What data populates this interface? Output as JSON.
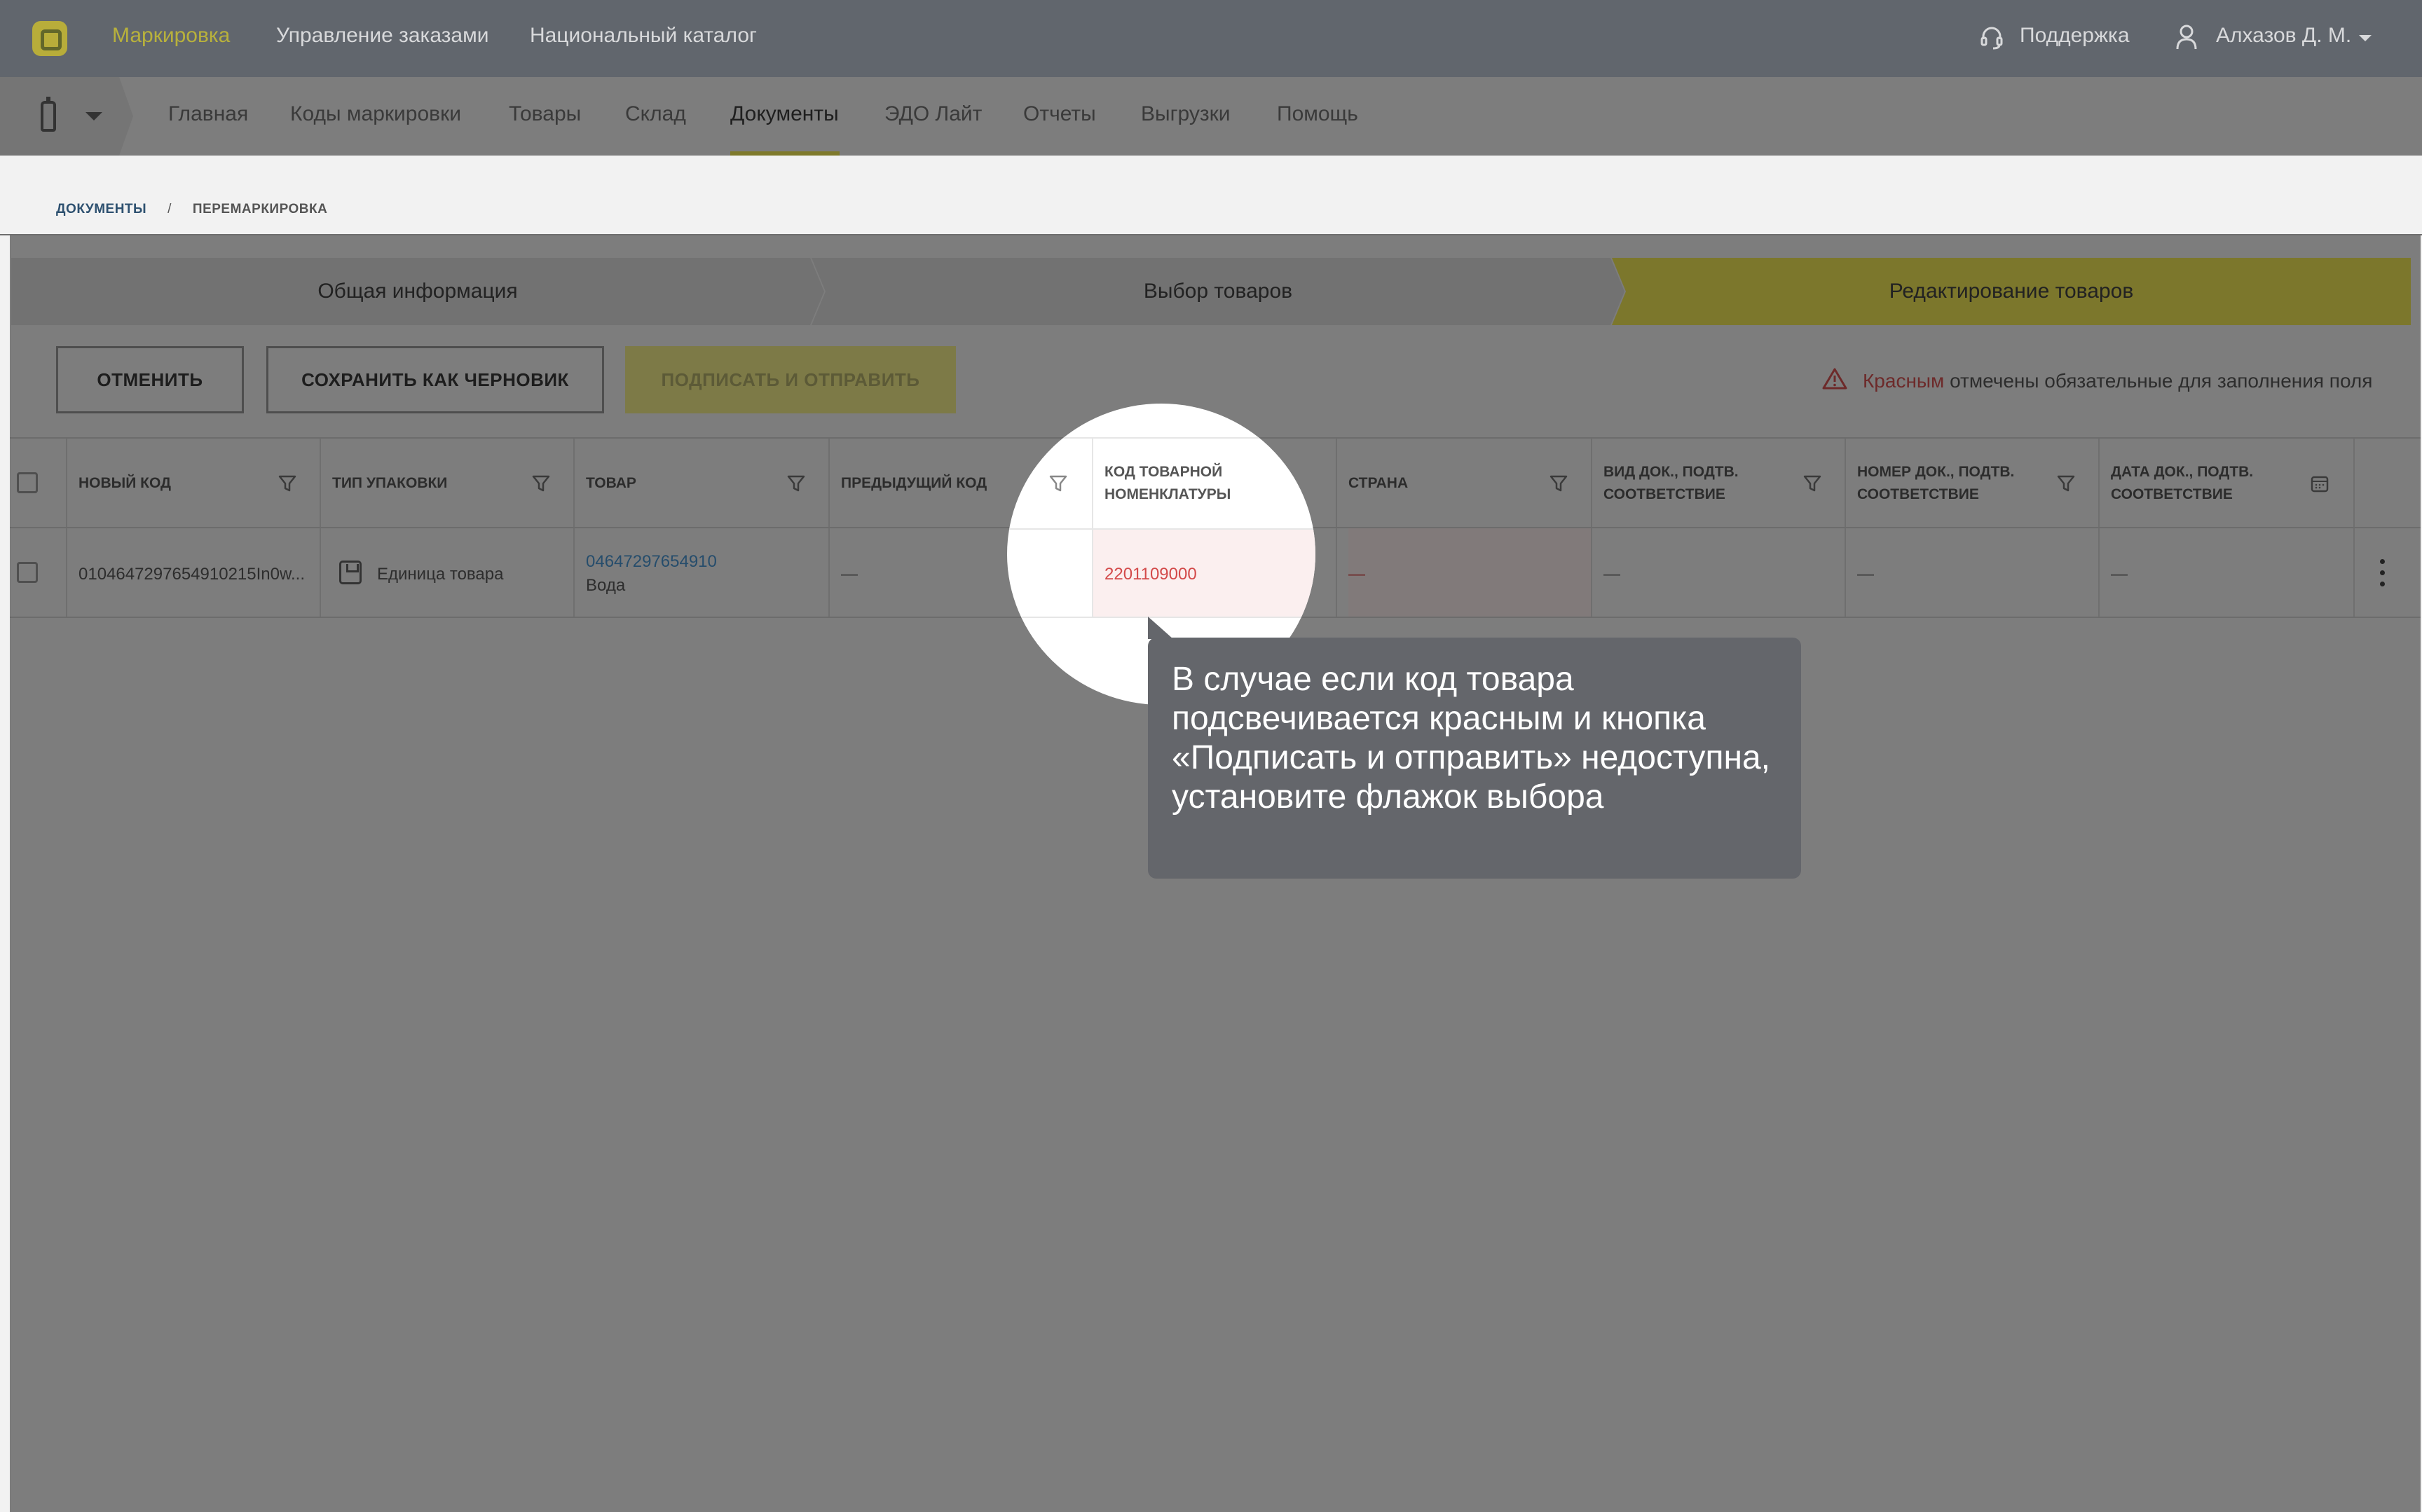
{
  "topbar": {
    "nav": [
      "Маркировка",
      "Управление заказами",
      "Национальный каталог"
    ],
    "active_index": 0,
    "support": "Поддержка",
    "user": "Алхазов Д. М."
  },
  "subnav": {
    "items": [
      "Главная",
      "Коды маркировки",
      "Товары",
      "Склад",
      "Документы",
      "ЭДО Лайт",
      "Отчеты",
      "Выгрузки",
      "Помощь"
    ],
    "active": "Документы"
  },
  "breadcrumb": {
    "root": "ДОКУМЕНТЫ",
    "separator": "/",
    "current": "ПЕРЕМАРКИРОВКА"
  },
  "steps": [
    "Общая информация",
    "Выбор товаров",
    "Редактирование товаров"
  ],
  "active_step": 2,
  "buttons": {
    "cancel": "ОТМЕНИТЬ",
    "save_draft": "СОХРАНИТЬ КАК ЧЕРНОВИК",
    "sign_send": "ПОДПИСАТЬ И ОТПРАВИТЬ"
  },
  "legend": {
    "red_word": "Красным",
    "rest": " отмечены обязательные для заполнения поля"
  },
  "table": {
    "headers": {
      "new_code": "НОВЫЙ КОД",
      "package_type": "ТИП УПАКОВКИ",
      "product": "ТОВАР",
      "previous_code": "ПРЕДЫДУЩИЙ КОД",
      "tnved_line1": "КОД ТОВАРНОЙ",
      "tnved_line2": "НОМЕНКЛАТУРЫ",
      "country": "СТРАНА",
      "doc_type_line1": "ВИД ДОК., ПОДТВ.",
      "doc_type_line2": "СООТВЕТСТВИЕ",
      "doc_number_line1": "НОМЕР ДОК., ПОДТВ.",
      "doc_number_line2": "СООТВЕТСТВИЕ",
      "doc_date_line1": "ДАТА ДОК., ПОДТВ.",
      "doc_date_line2": "СООТВЕТСТВИЕ"
    },
    "row": {
      "new_code": "0104647297654910215In0w...",
      "package_type": "Единица товара",
      "product_code": "04647297654910",
      "product_name": "Вода",
      "previous_code": "—",
      "tnved": "2201109000",
      "country": "—",
      "doc_type": "—",
      "doc_number": "—",
      "doc_date": "—"
    }
  },
  "tooltip": {
    "text": "В случае если код товара подсвечивается красным и кнопка «Подписать и отправить» недоступна, установите флажок выбора"
  },
  "colors": {
    "accent": "#e3d74e",
    "required_red": "#d34a4a",
    "tooltip_bg": "#64666b",
    "overlay": "#7d7d7d"
  }
}
